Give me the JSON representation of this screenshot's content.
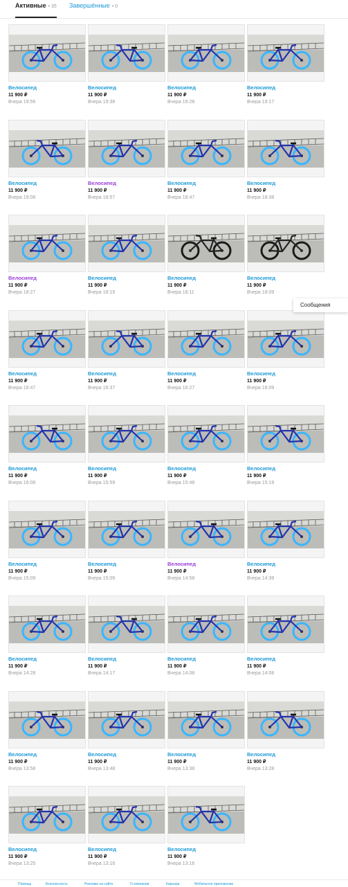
{
  "tabs": [
    {
      "label": "Активные",
      "count": "35"
    },
    {
      "label": "Завершённые",
      "count": "0"
    }
  ],
  "messages_label": "Сообщения",
  "items": [
    {
      "title": "Велосипед",
      "price": "11 900 ₽",
      "date": "Вчера 19:56"
    },
    {
      "title": "Велосипед",
      "price": "11 900 ₽",
      "date": "Вчера 19:38"
    },
    {
      "title": "Велосипед",
      "price": "11 900 ₽",
      "date": "Вчера 19:28"
    },
    {
      "title": "Велосипед",
      "price": "11 900 ₽",
      "date": "Вчера 19:17"
    },
    {
      "title": "Велосипед",
      "price": "11 900 ₽",
      "date": "Вчера 19:08"
    },
    {
      "title": "Велосипед",
      "price": "11 900 ₽",
      "date": "Вчера 18:57",
      "visited": true
    },
    {
      "title": "Велосипед",
      "price": "11 900 ₽",
      "date": "Вчера 18:47"
    },
    {
      "title": "Велосипед",
      "price": "11 900 ₽",
      "date": "Вчера 18:38"
    },
    {
      "title": "Велосипед",
      "price": "11 900 ₽",
      "date": "Вчера 18:27",
      "visited": true
    },
    {
      "title": "Велосипед",
      "price": "11 900 ₽",
      "date": "Вчера 18:19"
    },
    {
      "title": "Велосипед",
      "price": "11 900 ₽",
      "date": "Вчера 18:11",
      "bike": "black"
    },
    {
      "title": "Велосипед",
      "price": "11 900 ₽",
      "date": "Вчера 18:09",
      "bike": "black"
    },
    {
      "title": "Велосипед",
      "price": "11 900 ₽",
      "date": "Вчера 16:47"
    },
    {
      "title": "Велосипед",
      "price": "11 900 ₽",
      "date": "Вчера 16:37"
    },
    {
      "title": "Велосипед",
      "price": "11 900 ₽",
      "date": "Вчера 16:27"
    },
    {
      "title": "Велосипед",
      "price": "11 900 ₽",
      "date": "Вчера 16:09"
    },
    {
      "title": "Велосипед",
      "price": "11 900 ₽",
      "date": "Вчера 16:08"
    },
    {
      "title": "Велосипед",
      "price": "11 900 ₽",
      "date": "Вчера 15:59"
    },
    {
      "title": "Велосипед",
      "price": "11 900 ₽",
      "date": "Вчера 15:48"
    },
    {
      "title": "Велосипед",
      "price": "11 900 ₽",
      "date": "Вчера 15:19"
    },
    {
      "title": "Велосипед",
      "price": "11 900 ₽",
      "date": "Вчера 15:09"
    },
    {
      "title": "Велосипед",
      "price": "11 900 ₽",
      "date": "Вчера 15:09"
    },
    {
      "title": "Велосипед",
      "price": "11 900 ₽",
      "date": "Вчера 14:58",
      "visited": true
    },
    {
      "title": "Велосипед",
      "price": "11 900 ₽",
      "date": "Вчера 14:39"
    },
    {
      "title": "Велосипед",
      "price": "11 900 ₽",
      "date": "Вчера 14:28"
    },
    {
      "title": "Велосипед",
      "price": "11 900 ₽",
      "date": "Вчера 14:17"
    },
    {
      "title": "Велосипед",
      "price": "11 900 ₽",
      "date": "Вчера 14:08"
    },
    {
      "title": "Велосипед",
      "price": "11 900 ₽",
      "date": "Вчера 14:08"
    },
    {
      "title": "Велосипед",
      "price": "11 900 ₽",
      "date": "Вчера 13:58"
    },
    {
      "title": "Велосипед",
      "price": "11 900 ₽",
      "date": "Вчера 13:48"
    },
    {
      "title": "Велосипед",
      "price": "11 900 ₽",
      "date": "Вчера 13:38"
    },
    {
      "title": "Велосипед",
      "price": "11 900 ₽",
      "date": "Вчера 13:28"
    },
    {
      "title": "Велосипед",
      "price": "11 900 ₽",
      "date": "Вчера 13:25"
    },
    {
      "title": "Велосипед",
      "price": "11 900 ₽",
      "date": "Вчера 13:16"
    },
    {
      "title": "Велосипед",
      "price": "11 900 ₽",
      "date": "Вчера 13:16"
    }
  ],
  "footer_links": [
    "Помощь",
    "Безопасность",
    "Реклама на сайте",
    "О компании",
    "Карьера",
    "Мобильное приложение"
  ],
  "colors": {
    "link": "#1d9ad6",
    "visited": "#9b3dd6",
    "muted": "#9a9a9a",
    "bike_blue": "#2233aa",
    "rim_blue": "#38b6ff"
  }
}
